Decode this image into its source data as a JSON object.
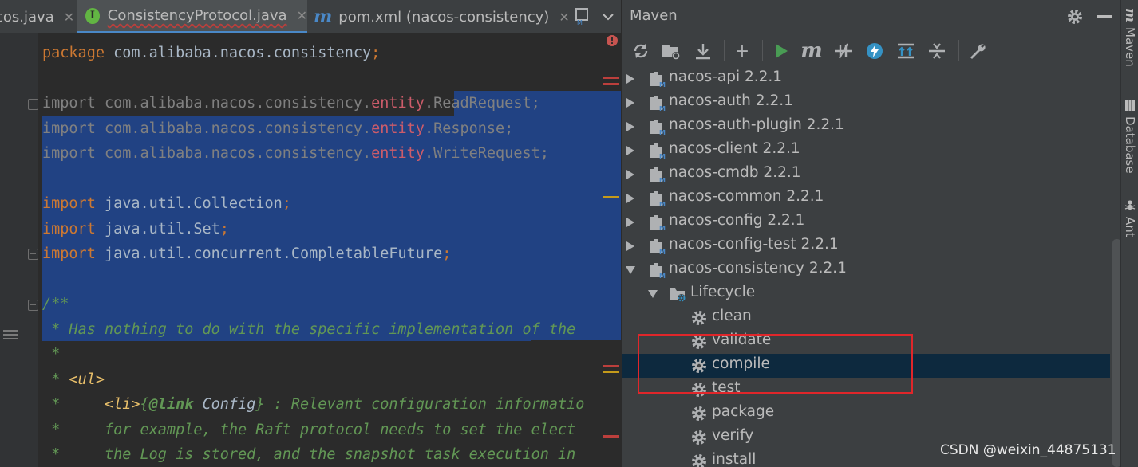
{
  "editor": {
    "tabs": [
      {
        "label": "cos.java",
        "icon": "java-file-icon"
      },
      {
        "label": "ConsistencyProtocol.java",
        "icon": "interface-icon",
        "badge": "I",
        "active": true
      },
      {
        "label": "pom.xml (nacos-consistency)",
        "icon": "maven-m-icon",
        "badge": "m"
      },
      {
        "label": "",
        "icon": "maven-module-icon"
      }
    ],
    "code_lines": [
      "package com.alibaba.nacos.consistency;",
      "",
      "import com.alibaba.nacos.consistency.entity.ReadRequest;",
      "import com.alibaba.nacos.consistency.entity.Response;",
      "import com.alibaba.nacos.consistency.entity.WriteRequest;",
      "",
      "import java.util.Collection;",
      "import java.util.Set;",
      "import java.util.concurrent.CompletableFuture;",
      "",
      "/**",
      " * Has nothing to do with the specific implementation of the",
      " *",
      " * <ul>",
      " *     <li>{@link Config} : Relevant configuration informatio",
      " *     for example, the Raft protocol needs to set the elect",
      " *     the Log is stored, and the snapshot task execution in"
    ]
  },
  "maven": {
    "title": "Maven",
    "toolbar": [
      "refresh-icon",
      "add-folder-icon",
      "download-icon",
      "plus-icon",
      "run-icon",
      "maven-goal-icon",
      "toggle-offline-icon",
      "skip-tests-icon",
      "show-dependencies-icon",
      "collapse-all-icon",
      "settings-wrench-icon"
    ],
    "toolbar_glyphs": {
      "m": "m",
      "plus": "+"
    },
    "modules": [
      {
        "label": "nacos-api 2.2.1",
        "expanded": false
      },
      {
        "label": "nacos-auth 2.2.1",
        "expanded": false
      },
      {
        "label": "nacos-auth-plugin 2.2.1",
        "expanded": false
      },
      {
        "label": "nacos-client 2.2.1",
        "expanded": false
      },
      {
        "label": "nacos-cmdb 2.2.1",
        "expanded": false
      },
      {
        "label": "nacos-common 2.2.1",
        "expanded": false
      },
      {
        "label": "nacos-config 2.2.1",
        "expanded": false
      },
      {
        "label": "nacos-config-test 2.2.1",
        "expanded": false
      },
      {
        "label": "nacos-consistency 2.2.1",
        "expanded": true
      }
    ],
    "lifecycle_label": "Lifecycle",
    "goals": [
      "clean",
      "validate",
      "compile",
      "test",
      "package",
      "verify",
      "install"
    ],
    "selected_goal": "compile"
  },
  "side_tools": [
    {
      "label": "Maven",
      "icon": "m"
    },
    {
      "label": "Database",
      "icon": "database-icon"
    },
    {
      "label": "Ant",
      "icon": "ant-icon"
    }
  ],
  "watermark": "CSDN @weixin_44875131",
  "colors": {
    "selection": "#214283",
    "highlight_box": "#e0262a",
    "selected_row": "#0d293e"
  }
}
